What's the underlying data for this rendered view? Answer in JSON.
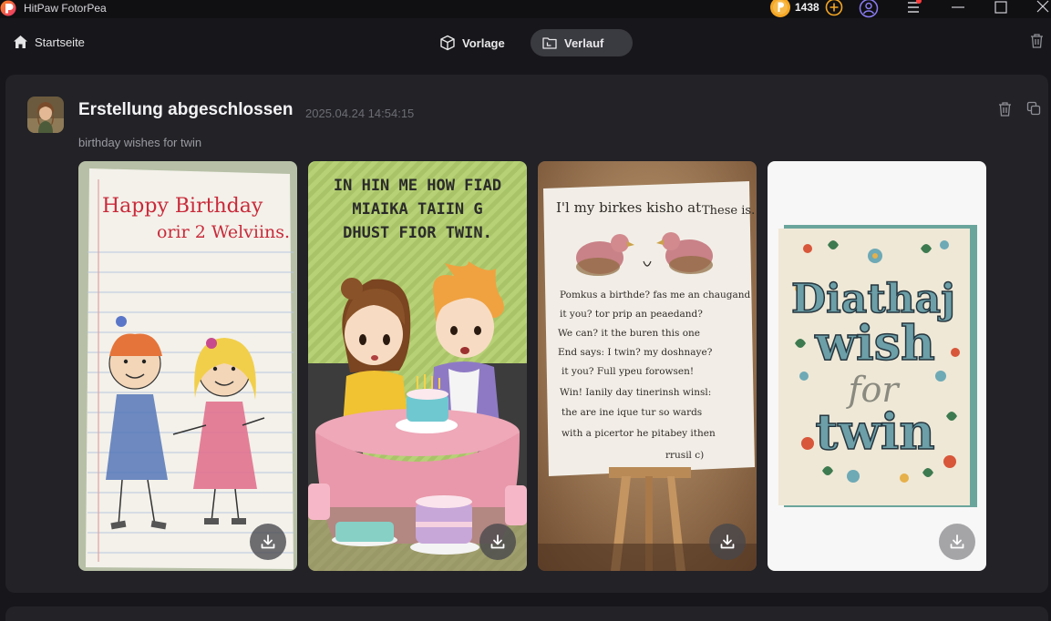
{
  "app": {
    "title": "HitPaw FotorPea",
    "coins": "1438"
  },
  "nav": {
    "home_label": "Startseite",
    "tabs": [
      {
        "label": "Vorlage",
        "active": false
      },
      {
        "label": "Verlauf",
        "active": true
      }
    ]
  },
  "history": {
    "card": {
      "status": "Erstellung abgeschlossen",
      "timestamp": "2025.04.24 14:54:15",
      "prompt": "birthday wishes for twin",
      "images": [
        {
          "name": "stick-figure-twins-card",
          "lines": [
            "Happy Birthday",
            "orir 2 Welviins."
          ]
        },
        {
          "name": "cartoon-kids-cake-card",
          "lines": [
            "IN HIN ME HOW FIAD",
            "MIAIKA TAIIN G",
            "DHUST FIOR TWIN."
          ]
        },
        {
          "name": "easel-handwritten-card",
          "lines": [
            "I'l my birkes kisho at",
            "These is.",
            "Pomkus a birthde? fas me an chaugand",
            "it you? tor prip an peaedand?",
            "We can? it the buren this one",
            "End says: I twin? my doshnaye?",
            "it you? Full ypeu forowsen!",
            "Win! Ianily day tinerinsh winsl:",
            "the are ine ique tur so wards",
            "with a picertor he pitabey ithen",
            "rrusil c)"
          ]
        },
        {
          "name": "floral-typography-card",
          "lines": [
            "Diathaj",
            "wish",
            "for",
            "twin"
          ]
        }
      ]
    }
  },
  "colors": {
    "accent": "#f5a623",
    "active_tab_bg": "#3a3a41",
    "card_bg": "#222227",
    "app_bg": "#17171b"
  }
}
